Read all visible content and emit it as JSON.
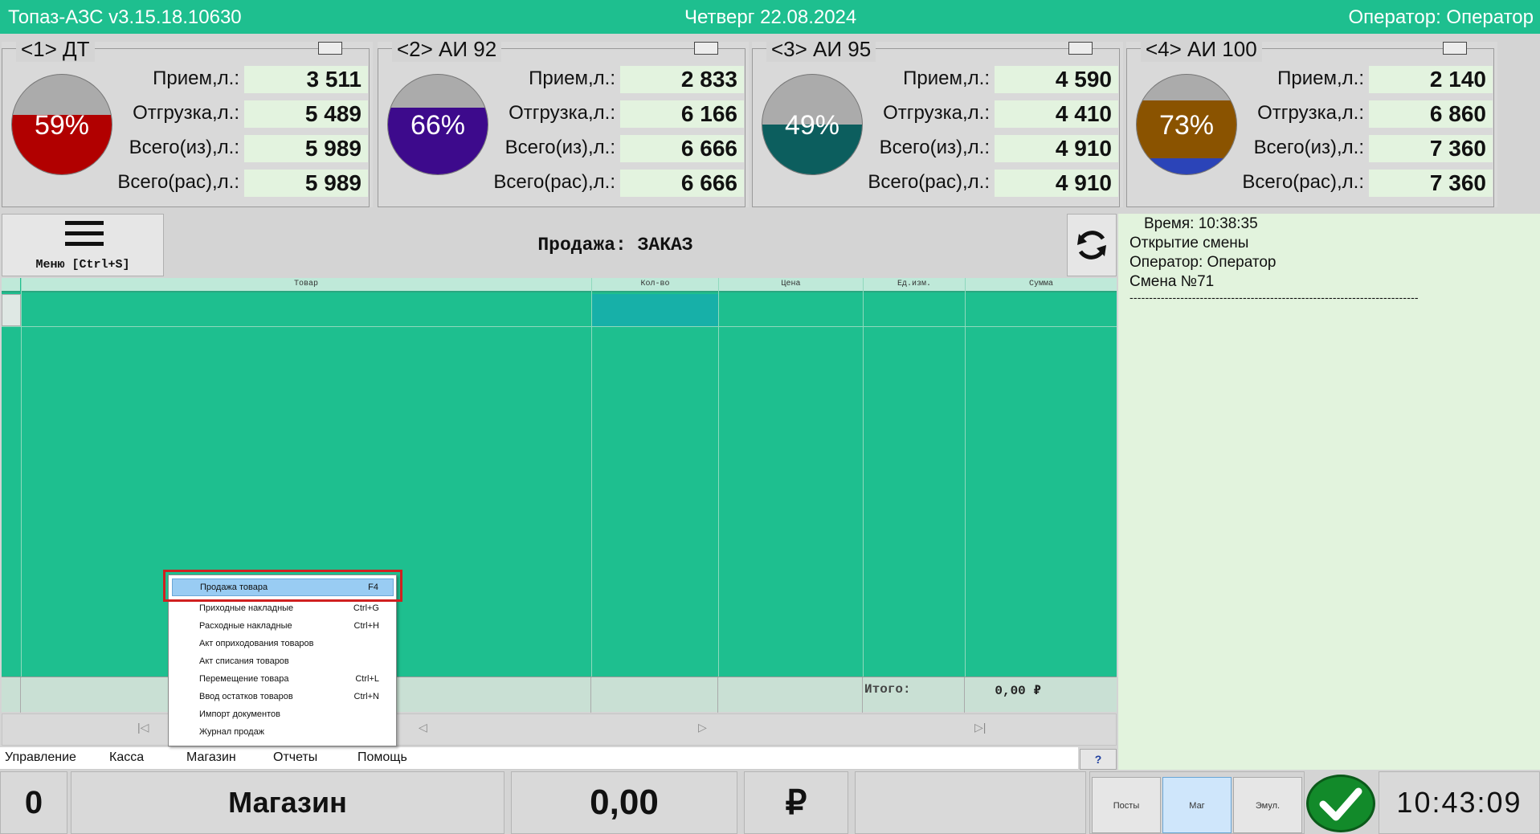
{
  "titlebar": {
    "app": "Топаз-АЗС  v3.15.18.10630",
    "date": "Четверг 22.08.2024",
    "operator": "Оператор: Оператор"
  },
  "tank_labels": {
    "received": "Прием,л.:",
    "shipped": "Отгрузка,л.:",
    "total_from": "Всего(из),л.:",
    "total_calc": "Всего(рас),л.:"
  },
  "tanks": [
    {
      "name": "<1> ДТ",
      "percent": "59%",
      "fill_level": 0.59,
      "fill_color": "#b10000",
      "received": "3 511",
      "shipped": "5 489",
      "total_from": "5 989",
      "total_calc": "5 989"
    },
    {
      "name": "<2> АИ 92",
      "percent": "66%",
      "fill_level": 0.66,
      "fill_color": "#3d0a8c",
      "received": "2 833",
      "shipped": "6 166",
      "total_from": "6 666",
      "total_calc": "6 666"
    },
    {
      "name": "<3> АИ 95",
      "percent": "49%",
      "fill_level": 0.49,
      "fill_color": "#0c5e5e",
      "received": "4 590",
      "shipped": "4 410",
      "total_from": "4 910",
      "total_calc": "4 910"
    },
    {
      "name": "<4> АИ 100",
      "percent": "73%",
      "fill_level": 0.73,
      "fill_color": "#8a5300",
      "water_color": "#2b44b8",
      "received": "2 140",
      "shipped": "6 860",
      "total_from": "7 360",
      "total_calc": "7 360"
    }
  ],
  "menu_button": {
    "label": "Меню [Ctrl+S]"
  },
  "sale_title": "Продажа: ЗАКАЗ",
  "grid": {
    "columns": [
      "Товар",
      "Кол-во",
      "Цена",
      "Ед.изм.",
      "Сумма"
    ],
    "total_label": "Итого:",
    "total_value": "0,00 ₽"
  },
  "navbar": {
    "first": "|◁",
    "prev": "◁",
    "next": "▷",
    "last": "▷|"
  },
  "menubar": [
    "Управление",
    "Касса",
    "Магазин",
    "Отчеты",
    "Помощь"
  ],
  "help_button": "?",
  "log": {
    "time": "Время: 10:38:35",
    "line1": "Открытие смены",
    "line2": "Оператор: Оператор",
    "line3": "Смена №71",
    "separator": "--------------------------------------------------------------------------"
  },
  "popup": [
    {
      "label": "Продажа товара",
      "shortcut": "F4"
    },
    {
      "label": "Приходные накладные",
      "shortcut": "Ctrl+G"
    },
    {
      "label": "Расходные накладные",
      "shortcut": "Ctrl+H"
    },
    {
      "label": "Акт оприходования товаров",
      "shortcut": ""
    },
    {
      "label": "Акт списания товаров",
      "shortcut": ""
    },
    {
      "label": "Перемещение товара",
      "shortcut": "Ctrl+L"
    },
    {
      "label": "Ввод остатков товаров",
      "shortcut": "Ctrl+N"
    },
    {
      "label": "Импорт документов",
      "shortcut": ""
    },
    {
      "label": "Журнал продаж",
      "shortcut": ""
    }
  ],
  "bottom": {
    "counter": "0",
    "mode": "Магазин",
    "amount": "0,00",
    "currency": "₽",
    "mode_buttons": [
      "Посты",
      "Маг",
      "Эмул."
    ],
    "clock": "10:43:09"
  }
}
